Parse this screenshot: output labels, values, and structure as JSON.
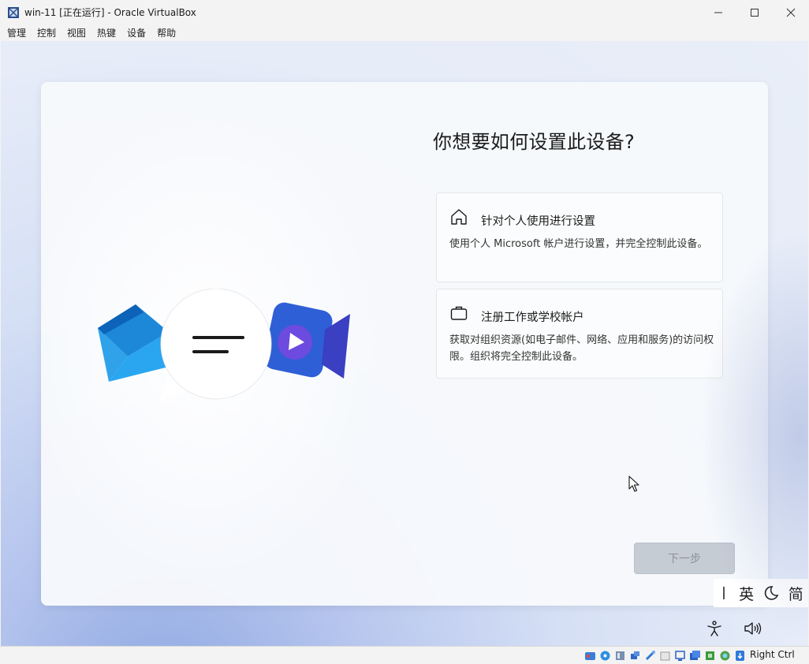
{
  "window": {
    "title": "win-11 [正在运行] - Oracle VirtualBox",
    "controls": [
      "minimize-icon",
      "maximize-icon",
      "close-icon"
    ]
  },
  "menu": {
    "items": [
      "管理",
      "控制",
      "视图",
      "热键",
      "设备",
      "帮助"
    ]
  },
  "oobe": {
    "title": "你想要如何设置此设备?",
    "options": [
      {
        "icon": "home-icon",
        "title": "针对个人使用进行设置",
        "description": "使用个人 Microsoft 帐户进行设置，并完全控制此设备。"
      },
      {
        "icon": "briefcase-icon",
        "title": "注册工作或学校帐户",
        "description": "获取对组织资源(如电子邮件、网络、应用和服务)的访问权限。组织将完全控制此设备。"
      }
    ],
    "next_label": "下一步",
    "next_enabled": false
  },
  "ime": {
    "mode": "英",
    "script": "简",
    "moon_icon": "moon-icon"
  },
  "tray": {
    "accessibility_icon": "accessibility-icon",
    "volume_icon": "volume-icon"
  },
  "statusbar": {
    "icons": [
      "hard-disk-icon",
      "optical-drive-icon",
      "audio-icon",
      "network-icon",
      "usb-icon",
      "shared-folder-icon",
      "display-icon",
      "recording-icon",
      "cpu-icon",
      "guest-additions-icon",
      "mouse-integration-icon"
    ],
    "host_key": "Right Ctrl"
  },
  "colors": {
    "next_disabled_bg": "#c6ccd4",
    "next_disabled_text": "#8a919a",
    "accent": "#0067c0"
  }
}
